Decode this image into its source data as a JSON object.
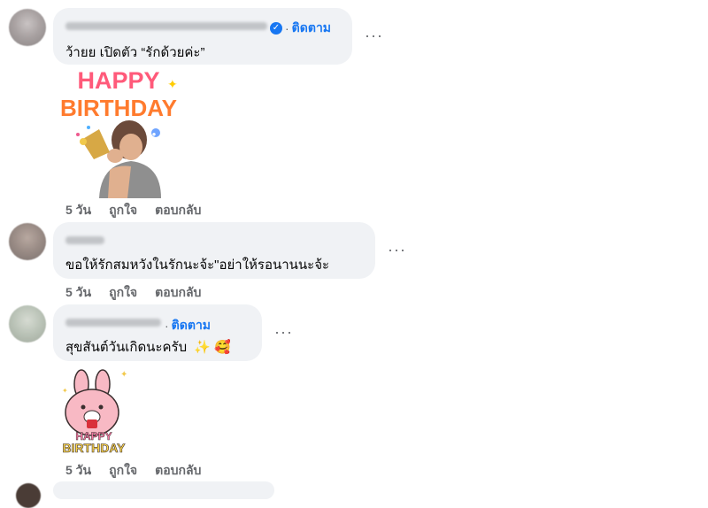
{
  "comments": [
    {
      "follow_label": "ติดตาม",
      "text": "ว้ายย เปิดตัว “รักด้วยค่ะ”",
      "sticker": {
        "line1": "HAPPY",
        "line2": "BIRTHDAY"
      },
      "time": "5 วัน",
      "like_label": "ถูกใจ",
      "reply_label": "ตอบกลับ"
    },
    {
      "text": "ขอให้รักสมหวังในรักนะจ้ะ\"อย่าให้รอนานนะจ้ะ",
      "time": "5 วัน",
      "like_label": "ถูกใจ",
      "reply_label": "ตอบกลับ"
    },
    {
      "follow_label": "ติดตาม",
      "text": "สุขสันต์วันเกิดนะครับ",
      "emoji": "✨ 🥰",
      "sticker": {
        "line1": "HAPPY",
        "line2": "BIRTHDAY"
      },
      "time": "5 วัน",
      "like_label": "ถูกใจ",
      "reply_label": "ตอบกลับ"
    }
  ],
  "more_icon": "···",
  "colors": {
    "link": "#1877f2",
    "bubble": "#f0f2f5",
    "meta": "#65676b"
  }
}
